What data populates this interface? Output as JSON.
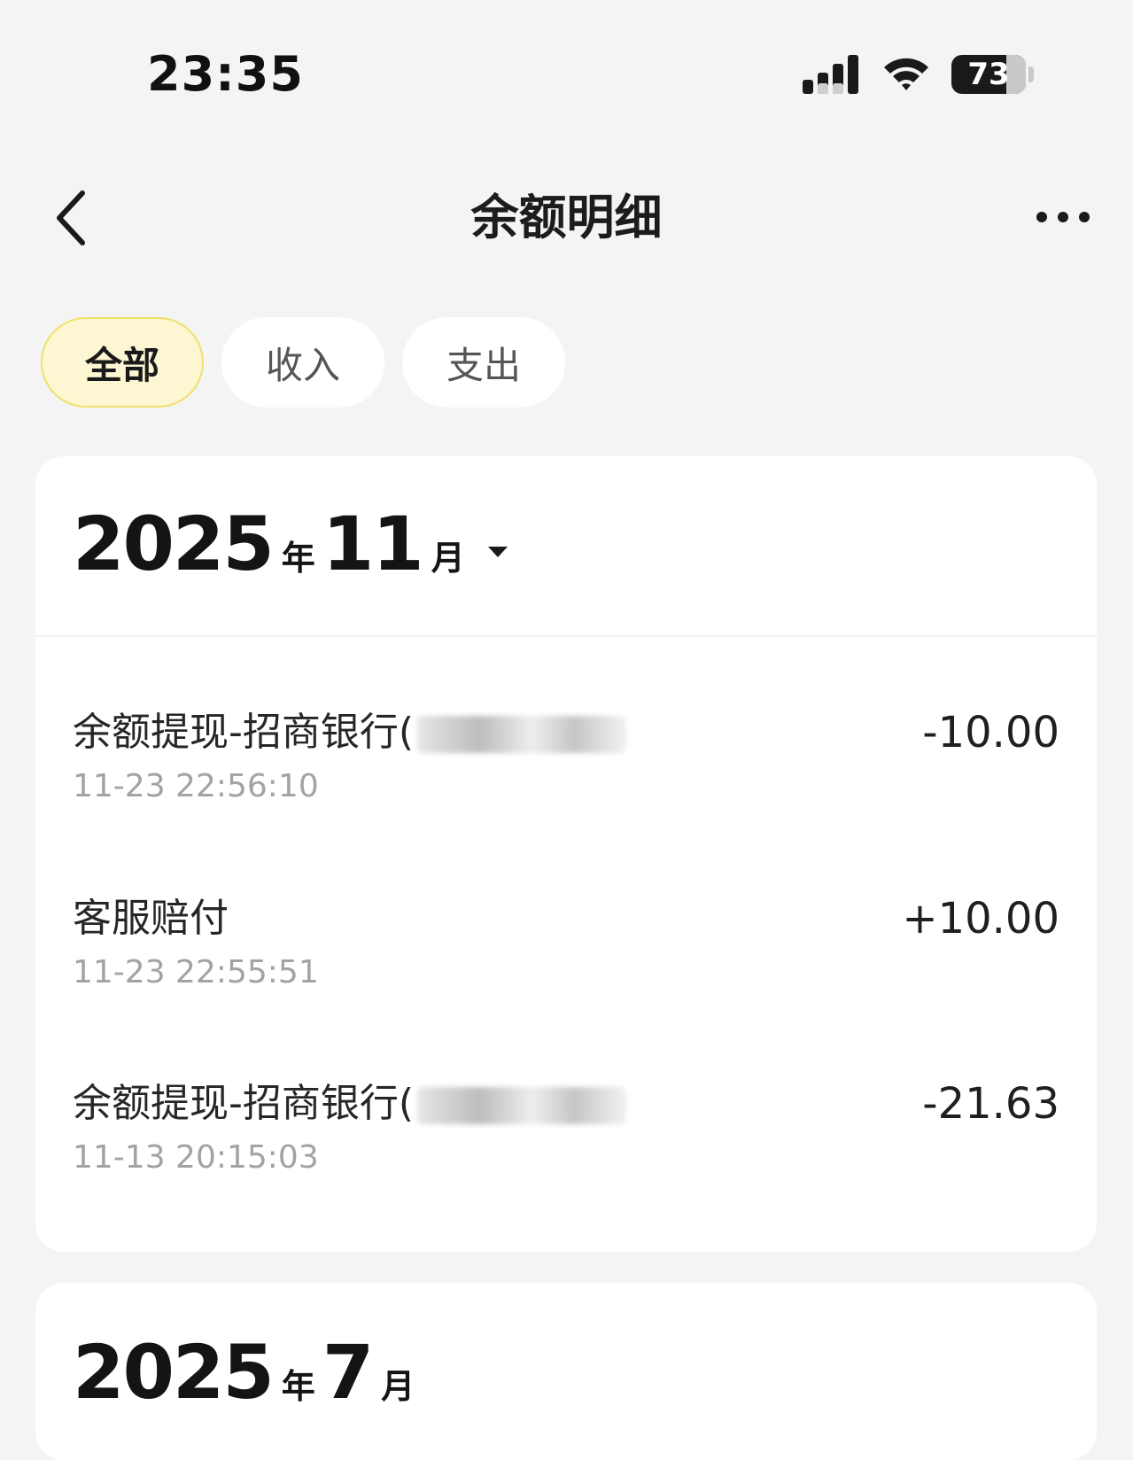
{
  "status": {
    "time": "23:35",
    "battery": "73"
  },
  "nav": {
    "title": "余额明细"
  },
  "filters": [
    {
      "label": "全部",
      "active": true
    },
    {
      "label": "收入",
      "active": false
    },
    {
      "label": "支出",
      "active": false
    }
  ],
  "months": [
    {
      "year": "2025",
      "year_unit": "年",
      "month": "11",
      "month_unit": "月",
      "transactions": [
        {
          "title": "余额提现-招商银行(",
          "time": "11-23 22:56:10",
          "amount": "-10.00"
        },
        {
          "title": "客服赔付",
          "time": "11-23 22:55:51",
          "amount": "+10.00"
        },
        {
          "title": "余额提现-招商银行(",
          "time": "11-13 20:15:03",
          "amount": "-21.63"
        }
      ]
    },
    {
      "year": "2025",
      "year_unit": "年",
      "month": "7",
      "month_unit": "月"
    }
  ]
}
